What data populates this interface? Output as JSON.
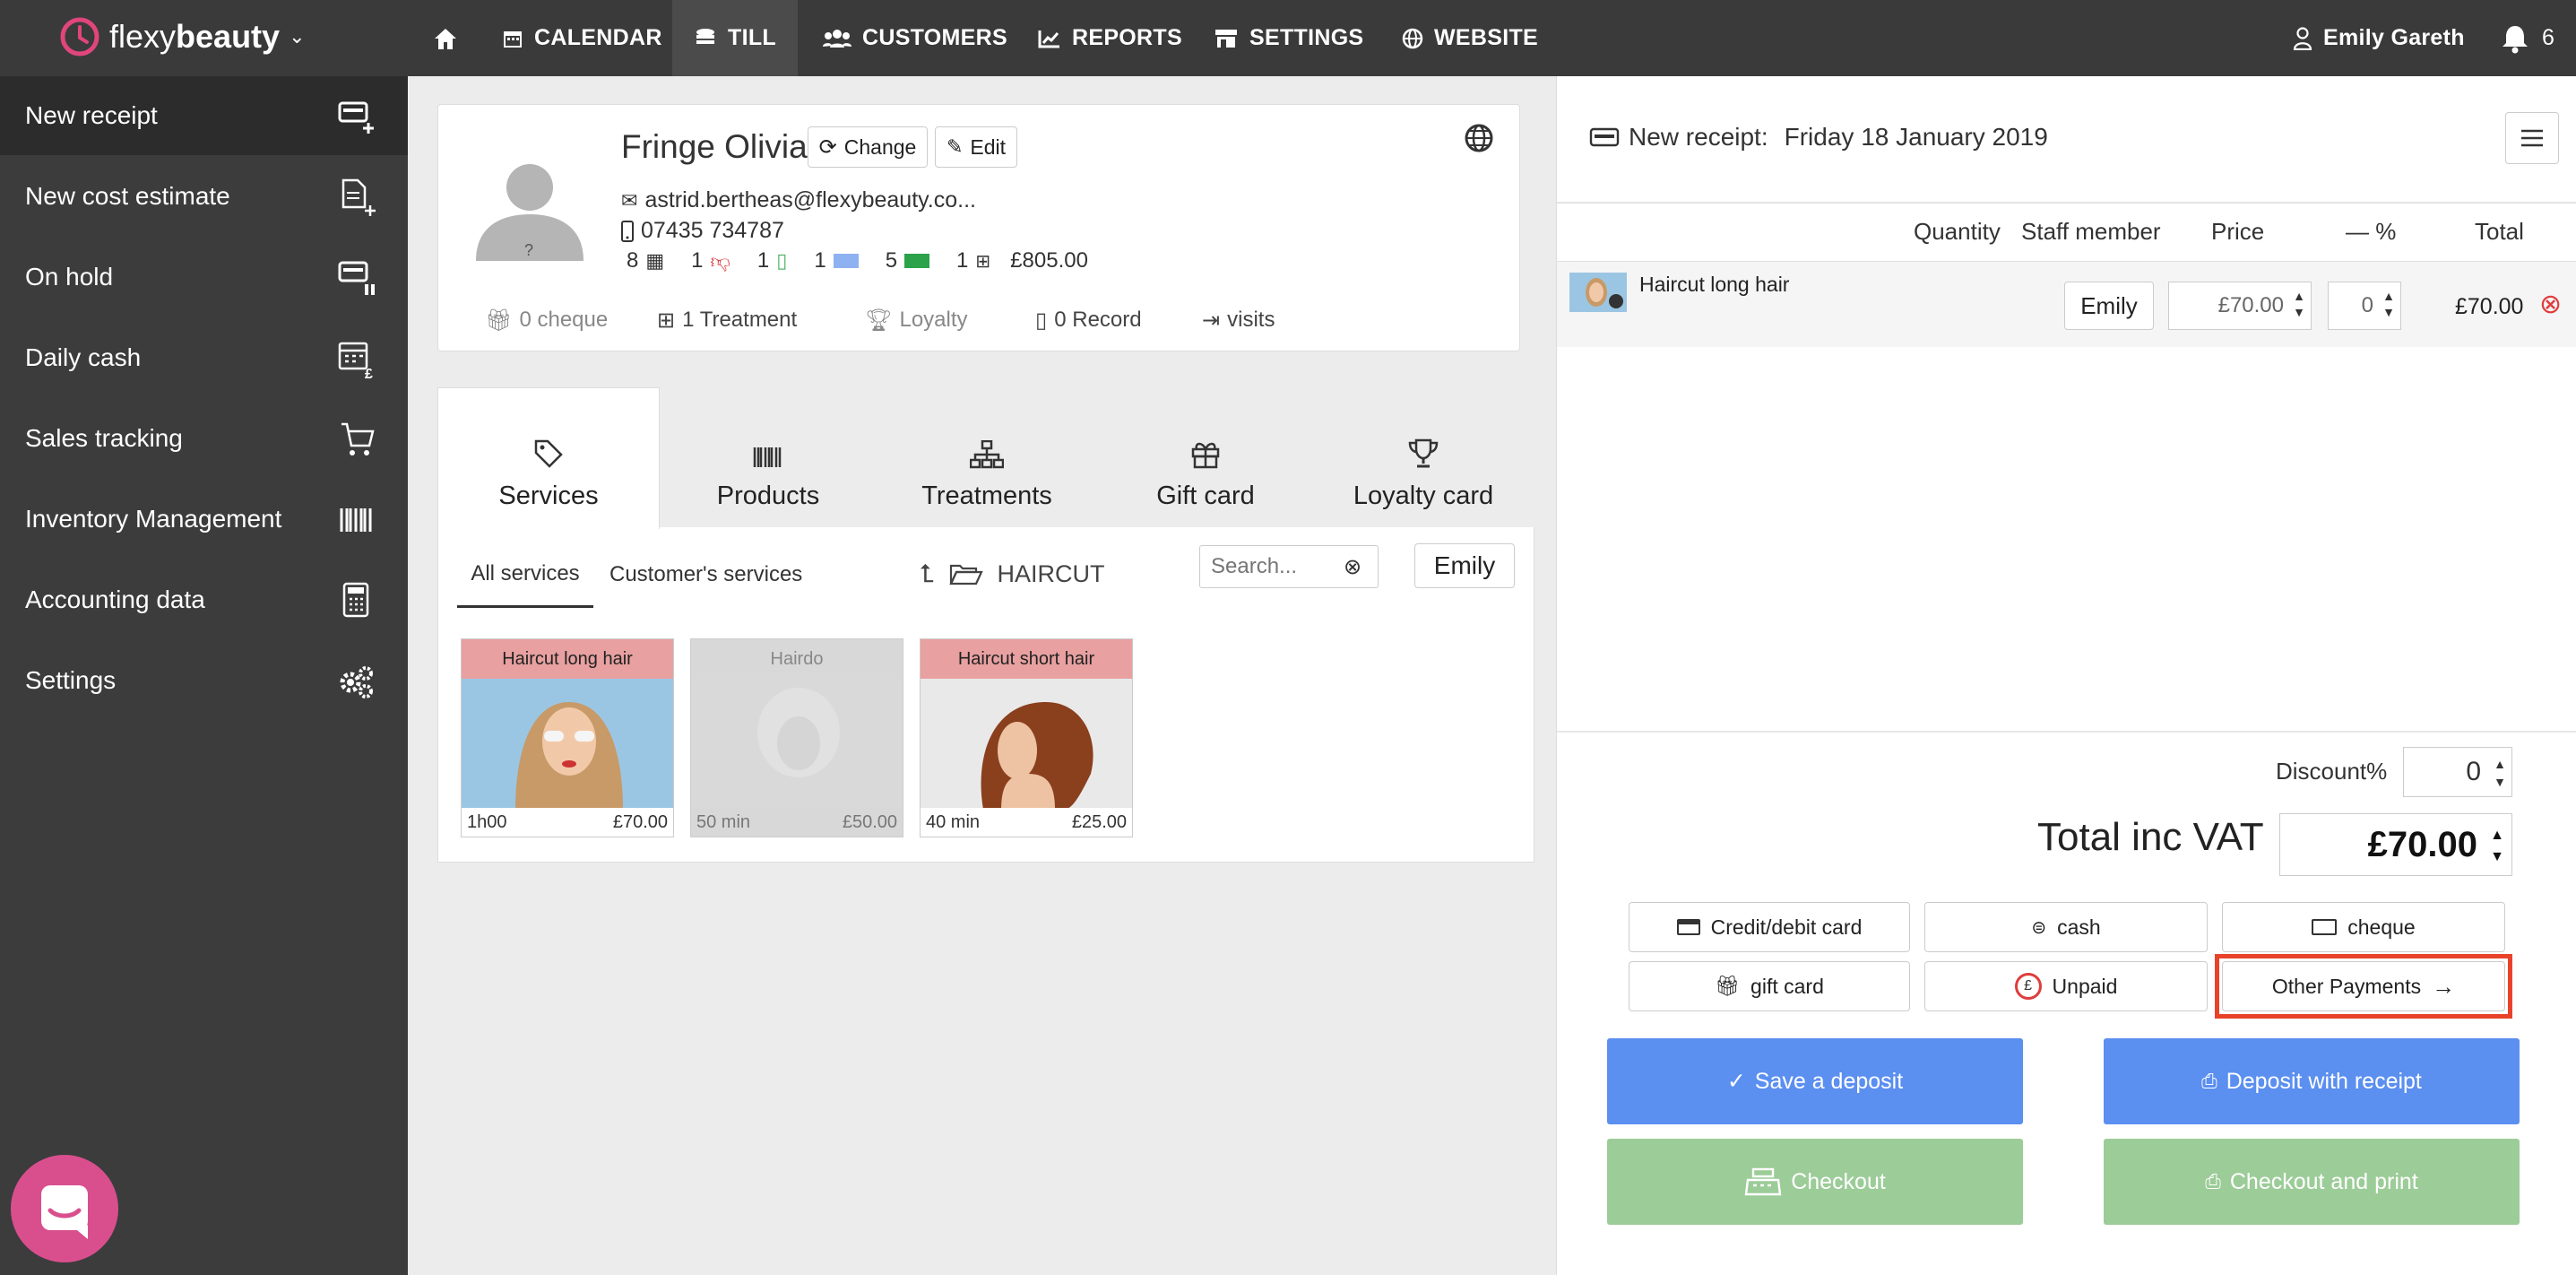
{
  "brand": {
    "name_light": "flexy",
    "name_bold": "beauty",
    "accent": "#e0457b"
  },
  "topnav": {
    "home_icon": "home-icon",
    "items": [
      {
        "label": "CALENDAR",
        "icon": "calendar-icon"
      },
      {
        "label": "TILL",
        "icon": "coins-icon"
      },
      {
        "label": "CUSTOMERS",
        "icon": "users-icon"
      },
      {
        "label": "REPORTS",
        "icon": "chart-icon"
      },
      {
        "label": "SETTINGS",
        "icon": "store-icon"
      },
      {
        "label": "WEBSITE",
        "icon": "globe-icon"
      }
    ],
    "user": "Emily Gareth",
    "notif_count": "6"
  },
  "sidebar": {
    "items": [
      {
        "label": "New receipt"
      },
      {
        "label": "New cost estimate"
      },
      {
        "label": "On hold"
      },
      {
        "label": "Daily cash"
      },
      {
        "label": "Sales tracking"
      },
      {
        "label": "Inventory Management"
      },
      {
        "label": "Accounting data"
      },
      {
        "label": "Settings"
      }
    ]
  },
  "customer": {
    "name": "Fringe Olivia",
    "change_label": "Change",
    "edit_label": "Edit",
    "email": "astrid.bertheas@flexybeauty.co...",
    "phone": "07435 734787",
    "counts": {
      "appointments": "8",
      "dislikes": "1",
      "docs": "1",
      "tickets": "1",
      "cards": "5",
      "treatments": "1",
      "spent": "£805.00"
    },
    "stats": {
      "cheque": "0 cheque",
      "treatment": "1 Treatment",
      "loyalty": "Loyalty",
      "record": "0 Record",
      "visits": "visits"
    }
  },
  "tabs": [
    {
      "label": "Services",
      "icon": "tag-icon"
    },
    {
      "label": "Products",
      "icon": "barcode-icon"
    },
    {
      "label": "Treatments",
      "icon": "sitemap-icon"
    },
    {
      "label": "Gift card",
      "icon": "gift-icon"
    },
    {
      "label": "Loyalty card",
      "icon": "trophy-icon"
    }
  ],
  "filters": {
    "all": "All services",
    "customer": "Customer's services",
    "folder": "HAIRCUT",
    "search_placeholder": "Search...",
    "staff": "Emily"
  },
  "services": [
    {
      "name": "Haircut long hair",
      "duration": "1h00",
      "price": "£70.00",
      "disabled": false
    },
    {
      "name": "Hairdo",
      "duration": "50 min",
      "price": "£50.00",
      "disabled": true
    },
    {
      "name": "Haircut short hair",
      "duration": "40 min",
      "price": "£25.00",
      "disabled": false
    }
  ],
  "receipt": {
    "title": "New receipt:",
    "date": "Friday 18 January 2019",
    "headers": {
      "quantity": "Quantity",
      "staff": "Staff member",
      "price": "Price",
      "discount": "— %",
      "total": "Total"
    },
    "line": {
      "name": "Haircut long hair",
      "staff": "Emily",
      "price": "£70.00",
      "discount": "0",
      "total": "£70.00"
    },
    "discount_label": "Discount%",
    "discount_value": "0",
    "total_label": "Total inc VAT",
    "total_value": "£70.00"
  },
  "payments": [
    {
      "label": "Credit/debit card",
      "icon": "credit-card-icon"
    },
    {
      "label": "cash",
      "icon": "cash-icon"
    },
    {
      "label": "cheque",
      "icon": "cheque-icon"
    },
    {
      "label": "gift card",
      "icon": "gift-icon"
    },
    {
      "label": "Unpaid",
      "icon": "unpaid-icon"
    },
    {
      "label": "Other Payments",
      "icon": "arrow-right-icon"
    }
  ],
  "actions": {
    "save_deposit": "Save a deposit",
    "deposit_receipt": "Deposit with receipt",
    "checkout": "Checkout",
    "checkout_print": "Checkout and print"
  },
  "colors": {
    "blue": "#5b8ff0",
    "green": "#9ccc98",
    "highlight": "#e8432a",
    "pink_label": "#e8a0a0"
  }
}
